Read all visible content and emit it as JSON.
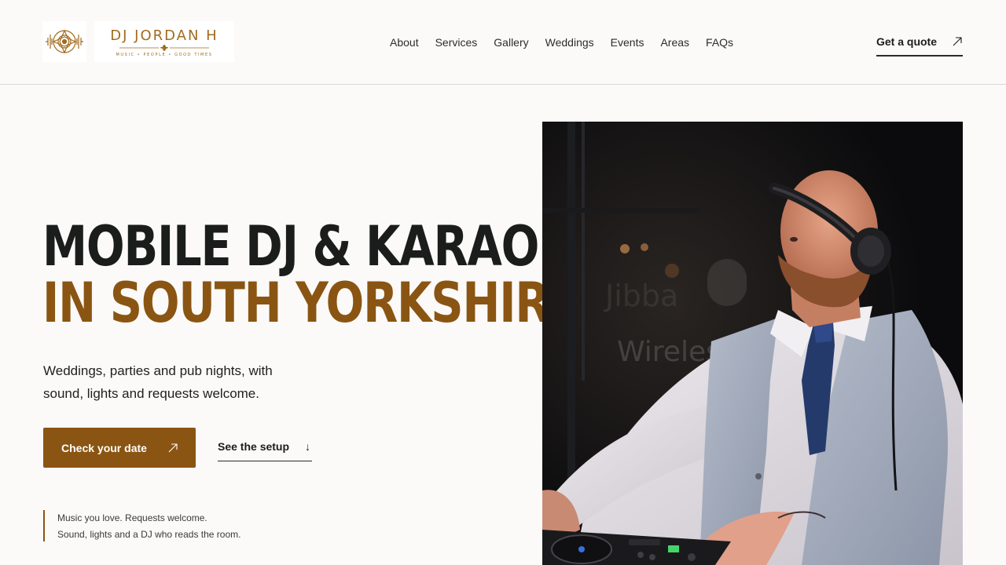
{
  "brand": {
    "name": "DJ JORDAN H",
    "tagline": "MUSIC • PEOPLE • GOOD TIMES"
  },
  "nav": {
    "items": [
      {
        "label": "About"
      },
      {
        "label": "Services"
      },
      {
        "label": "Gallery"
      },
      {
        "label": "Weddings"
      },
      {
        "label": "Events"
      },
      {
        "label": "Areas"
      },
      {
        "label": "FAQs"
      }
    ],
    "cta_label": "Get a quote"
  },
  "hero": {
    "headline_line1": "MOBILE DJ & KARAOKE",
    "headline_line2": "IN SOUTH YORKSHIRE.",
    "lede": "Weddings, parties and pub nights, with sound, lights and requests welcome.",
    "primary_cta": "Check your date",
    "secondary_cta": "See the setup",
    "note_line1": "Music you love. Requests welcome.",
    "note_line2": "Sound, lights and a DJ who reads the room."
  },
  "colors": {
    "accent": "#8a5512",
    "text": "#1b1d1c",
    "background": "#fbfaf8"
  },
  "icons": {
    "logo_mark": "mandala-icon",
    "primary_arrow": "arrow-up-right-icon",
    "quote_arrow": "arrow-up-right-icon",
    "secondary_arrow": "arrow-down-icon"
  }
}
